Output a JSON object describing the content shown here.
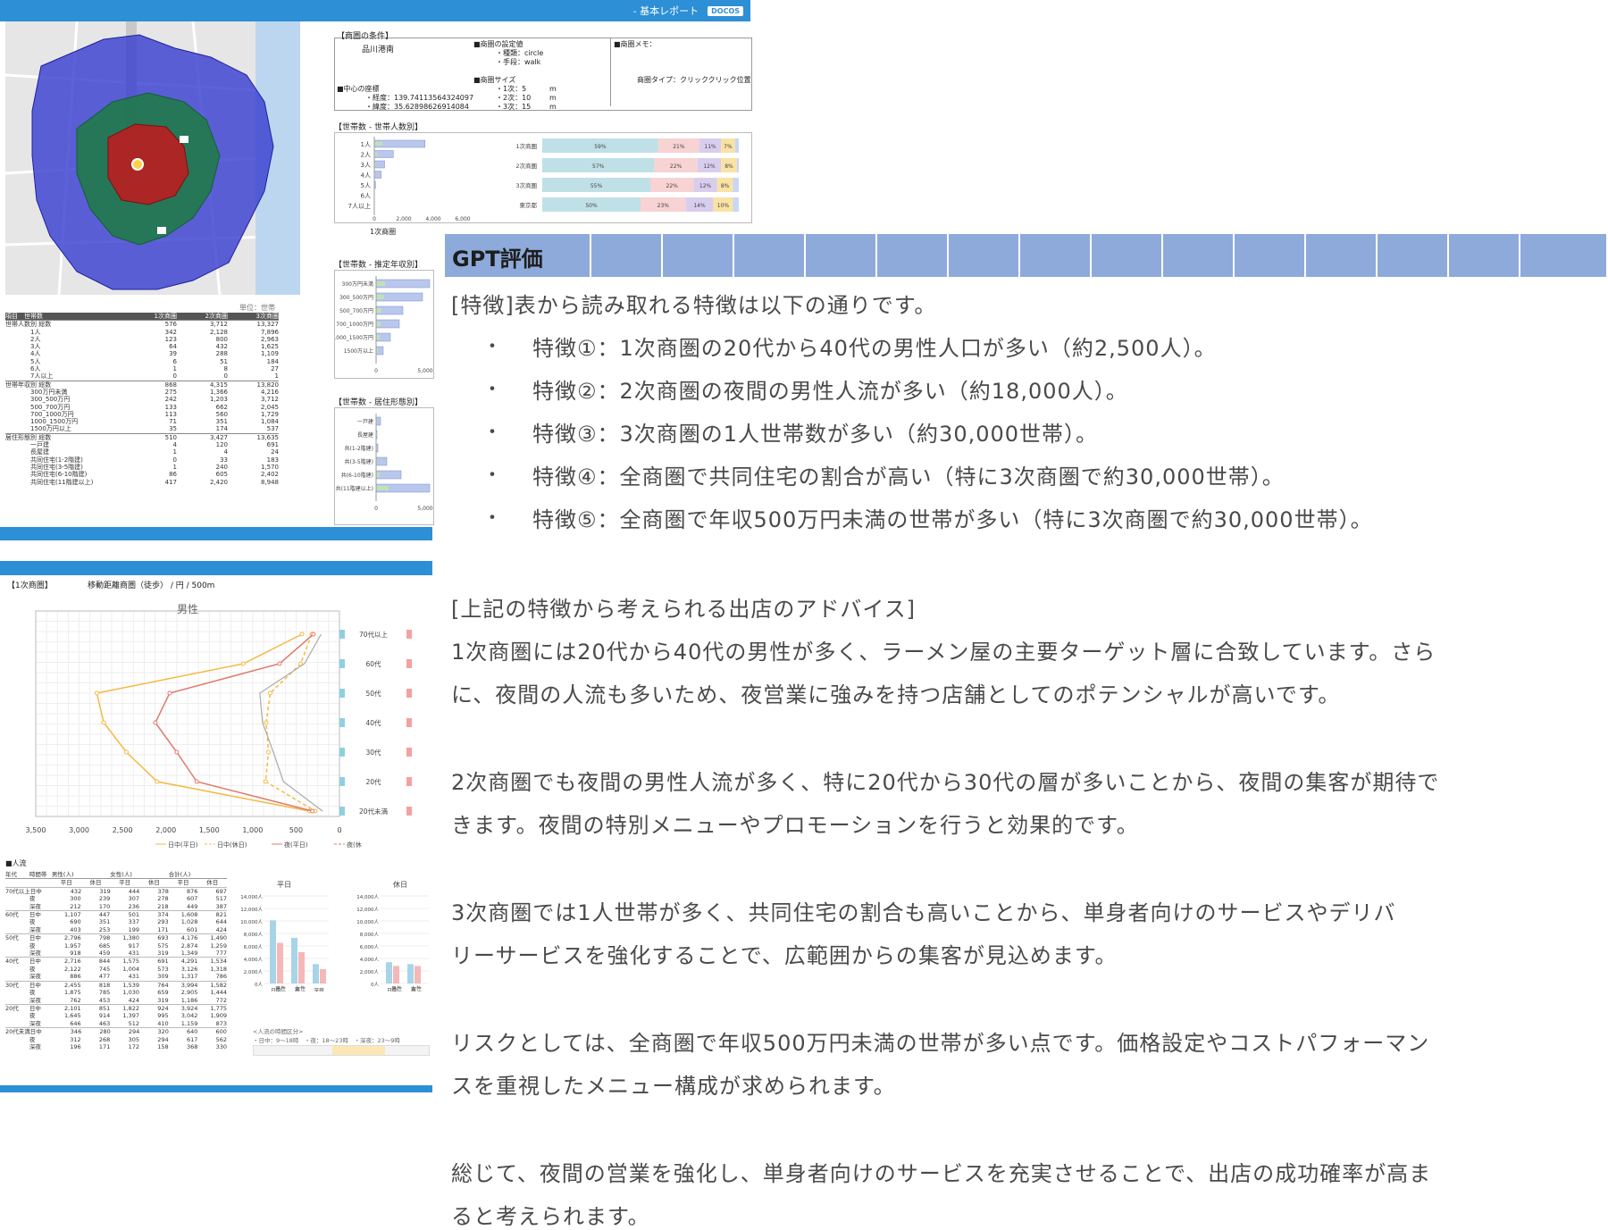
{
  "report": {
    "title": "- 基本レポート",
    "logo_text": "DOCOS",
    "conditions_header": "【商圏の条件】",
    "area_name": "品川港南",
    "center_label": "■中心の座標",
    "longitude": "・経度：139.74113564324097",
    "latitude": "・緯度：35.62898626914084",
    "settings_label": "■商圏の設定値",
    "settings_kind": "・種類：circle",
    "settings_method": "・手段：walk",
    "size_label": "■商圏サイズ",
    "size_1": "・1次：5",
    "size_2": "・2次：10",
    "size_3": "・3次：15",
    "unit_m": "m",
    "memo_label": "■商圏メモ：",
    "type_label": "商圏タイプ：クリッククリック位置",
    "hh_section": "【世帯数 - 世帯人数別】",
    "income_section": "【世帯数 - 推定年収別】",
    "housing_section": "【世帯数 - 居住形態別】",
    "unit_note": "単位：世帯",
    "hh_labels": [
      "1人",
      "2人",
      "3人",
      "4人",
      "5人",
      "6人",
      "7人以上"
    ],
    "pct_rows": [
      {
        "label": "1次商圏",
        "vals": [
          "59%",
          "21%",
          "11%",
          "7%"
        ]
      },
      {
        "label": "2次商圏",
        "vals": [
          "57%",
          "22%",
          "12%",
          "8%"
        ]
      },
      {
        "label": "3次商圏",
        "vals": [
          "55%",
          "22%",
          "12%",
          "8%"
        ]
      },
      {
        "label": "東京都",
        "vals": [
          "50%",
          "23%",
          "14%",
          "10%"
        ]
      }
    ],
    "income_labels": [
      "300万円未満",
      "300_500万円",
      "500_700万円",
      "700_1000万円",
      "1000_1500万円",
      "1500万以上"
    ],
    "housing_labels": [
      "一戸建",
      "長屋建",
      "共(1-2階建)",
      "共(3-5階建)",
      "共(6-10階建)",
      "共(11階建以上)"
    ],
    "axis_hh": [
      "0",
      "2,000",
      "4,000",
      "6,000"
    ],
    "axis_5000": [
      "0",
      "5,000"
    ],
    "legend_1": "1次商圏",
    "legend_2": "2次商圏",
    "table_head": [
      "項目",
      "世帯数",
      "1次商圏",
      "2次商圏",
      "3次商圏"
    ],
    "table_rows": [
      [
        "世帯人数別 総数",
        "",
        "576",
        "3,712",
        "13,327"
      ],
      [
        "1人",
        "",
        "342",
        "2,128",
        "7,896"
      ],
      [
        "2人",
        "",
        "123",
        "800",
        "2,963"
      ],
      [
        "3人",
        "",
        "64",
        "432",
        "1,625"
      ],
      [
        "4人",
        "",
        "39",
        "288",
        "1,109"
      ],
      [
        "5人",
        "",
        "6",
        "51",
        "184"
      ],
      [
        "6人",
        "",
        "1",
        "8",
        "27"
      ],
      [
        "7人以上",
        "",
        "0",
        "0",
        "1"
      ],
      [
        "世帯年収別 総数",
        "",
        "868",
        "4,315",
        "13,820"
      ],
      [
        "300万円未満",
        "",
        "275",
        "1,366",
        "4,216"
      ],
      [
        "300_500万円",
        "",
        "242",
        "1,203",
        "3,712"
      ],
      [
        "500_700万円",
        "",
        "133",
        "662",
        "2,045"
      ],
      [
        "700_1000万円",
        "",
        "113",
        "560",
        "1,729"
      ],
      [
        "1000_1500万円",
        "",
        "71",
        "351",
        "1,084"
      ],
      [
        "1500万円以上",
        "",
        "35",
        "174",
        "537"
      ],
      [
        "居住形態別 総数",
        "",
        "510",
        "3,427",
        "13,635"
      ],
      [
        "一戸建",
        "",
        "4",
        "120",
        "691"
      ],
      [
        "長屋建",
        "",
        "1",
        "4",
        "24"
      ],
      [
        "共同住宅(1-2階建)",
        "",
        "0",
        "33",
        "183"
      ],
      [
        "共同住宅(3-5階建)",
        "",
        "1",
        "240",
        "1,570"
      ],
      [
        "共同住宅(6-10階建)",
        "",
        "86",
        "605",
        "2,402"
      ],
      [
        "共同住宅(11階建以上)",
        "",
        "417",
        "2,420",
        "8,948"
      ]
    ]
  },
  "panel2": {
    "section": "【1次商圏】",
    "subtitle": "移動距離商圏（徒歩） / 円 / 500m",
    "chart_title": "男性",
    "age_labels": [
      "70代以上",
      "60代",
      "50代",
      "40代",
      "30代",
      "20代",
      "20代未満"
    ],
    "x_ticks": [
      "3,500",
      "3,000",
      "2,500",
      "2,000",
      "1,500",
      "1,000",
      "500",
      "0"
    ],
    "legend": [
      "日中(平日)",
      "日中(休日)",
      "夜(平日)",
      "夜(休"
    ],
    "flow_label": "■人流",
    "flow_head": [
      "年代",
      "時間帯",
      "男性(人)",
      "女性(人)",
      "合計(人)"
    ],
    "flow_sub": [
      "平日",
      "休日",
      "平日",
      "休日",
      "平日",
      "休日"
    ],
    "flow_rows": [
      [
        "70代以上",
        "日中",
        "432",
        "319",
        "444",
        "378",
        "876",
        "697"
      ],
      [
        "",
        "夜",
        "300",
        "239",
        "307",
        "278",
        "607",
        "517"
      ],
      [
        "",
        "深夜",
        "212",
        "170",
        "236",
        "218",
        "449",
        "387"
      ],
      [
        "60代",
        "日中",
        "1,107",
        "447",
        "501",
        "374",
        "1,608",
        "821"
      ],
      [
        "",
        "夜",
        "690",
        "351",
        "337",
        "293",
        "1,028",
        "644"
      ],
      [
        "",
        "深夜",
        "403",
        "253",
        "199",
        "171",
        "601",
        "424"
      ],
      [
        "50代",
        "日中",
        "2,796",
        "798",
        "1,380",
        "693",
        "4,176",
        "1,490"
      ],
      [
        "",
        "夜",
        "1,957",
        "685",
        "917",
        "575",
        "2,874",
        "1,259"
      ],
      [
        "",
        "深夜",
        "918",
        "459",
        "431",
        "319",
        "1,349",
        "777"
      ],
      [
        "40代",
        "日中",
        "2,716",
        "844",
        "1,575",
        "691",
        "4,291",
        "1,534"
      ],
      [
        "",
        "夜",
        "2,122",
        "745",
        "1,004",
        "573",
        "3,126",
        "1,318"
      ],
      [
        "",
        "深夜",
        "886",
        "477",
        "431",
        "309",
        "1,317",
        "786"
      ],
      [
        "30代",
        "日中",
        "2,455",
        "818",
        "1,539",
        "764",
        "3,994",
        "1,582"
      ],
      [
        "",
        "夜",
        "1,875",
        "785",
        "1,030",
        "659",
        "2,905",
        "1,444"
      ],
      [
        "",
        "深夜",
        "762",
        "453",
        "424",
        "319",
        "1,186",
        "772"
      ],
      [
        "20代",
        "日中",
        "2,101",
        "851",
        "1,822",
        "924",
        "3,924",
        "1,775"
      ],
      [
        "",
        "夜",
        "1,645",
        "914",
        "1,397",
        "995",
        "3,042",
        "1,909"
      ],
      [
        "",
        "深夜",
        "646",
        "463",
        "512",
        "410",
        "1,159",
        "873"
      ],
      [
        "20代未満",
        "日中",
        "346",
        "280",
        "294",
        "320",
        "640",
        "600"
      ],
      [
        "",
        "夜",
        "312",
        "268",
        "305",
        "294",
        "617",
        "562"
      ],
      [
        "",
        "深夜",
        "196",
        "171",
        "172",
        "158",
        "368",
        "330"
      ]
    ],
    "mini_titles": [
      "平日",
      "休日"
    ],
    "mini_y": [
      "14,000人",
      "12,000人",
      "10,000人",
      "8,000人",
      "6,000人",
      "4,000人",
      "2,000人",
      "0人"
    ],
    "mini_x": [
      "日中",
      "夜",
      "深夜"
    ],
    "mini_legend": [
      "男性",
      "女性"
    ],
    "time_note": "<人流の時間区分>",
    "time_segments": "・日中：9～18時　・夜：18～23時　・深夜：23～9時"
  },
  "gpt": {
    "title": "GPT評価",
    "intro": "[特徴]表から読み取れる特徴は以下の通りです。",
    "features": [
      "特徴①：1次商圏の20代から40代の男性人口が多い（約2,500人）。",
      "特徴②：2次商圏の夜間の男性人流が多い（約18,000人）。",
      "特徴③：3次商圏の1人世帯数が多い（約30,000世帯）。",
      "特徴④：全商圏で共同住宅の割合が高い（特に3次商圏で約30,000世帯）。",
      "特徴⑤：全商圏で年収500万円未満の世帯が多い（特に3次商圏で約30,000世帯）。"
    ],
    "bullet": "・",
    "advice_header": "[上記の特徴から考えられる出店のアドバイス]",
    "para1": [
      "1次商圏には20代から40代の男性が多く、ラーメン屋の主要ターゲット層に合致しています。さら",
      "に、夜間の人流も多いため、夜営業に強みを持つ店舗としてのポテンシャルが高いです。"
    ],
    "para2": [
      "2次商圏でも夜間の男性人流が多く、特に20代から30代の層が多いことから、夜間の集客が期待で",
      "きます。夜間の特別メニューやプロモーションを行うと効果的です。"
    ],
    "para3": [
      "3次商圏では1人世帯が多く、共同住宅の割合も高いことから、単身者向けのサービスやデリバ",
      "リーサービスを強化することで、広範囲からの集客が見込めます。"
    ],
    "para4": [
      "リスクとしては、全商圏で年収500万円未満の世帯が多い点です。価格設定やコストパフォーマン",
      "スを重視したメニュー構成が求められます。"
    ],
    "para5": [
      "総じて、夜間の営業を強化し、単身者向けのサービスを充実させることで、出店の成功確率が高ま",
      "ると考えられます。"
    ]
  },
  "chart_data": [
    {
      "type": "bar",
      "title": "世帯数 - 世帯人数別",
      "categories": [
        "1人",
        "2人",
        "3人",
        "4人",
        "5人",
        "6人",
        "7人以上"
      ],
      "series": [
        {
          "name": "1次商圏",
          "values": [
            342,
            123,
            64,
            39,
            6,
            1,
            0
          ]
        },
        {
          "name": "2次商圏",
          "values": [
            2128,
            800,
            432,
            288,
            51,
            8,
            0
          ]
        }
      ],
      "xlim": [
        0,
        6000
      ]
    },
    {
      "type": "line",
      "title": "男性",
      "categories": [
        "70代以上",
        "60代",
        "50代",
        "40代",
        "30代",
        "20代",
        "20代未満"
      ],
      "series": [
        {
          "name": "日中(平日)",
          "values": [
            432,
            1107,
            2796,
            2716,
            2455,
            2101,
            346
          ]
        },
        {
          "name": "日中(休日)",
          "values": [
            319,
            447,
            798,
            844,
            818,
            851,
            280
          ]
        },
        {
          "name": "夜(平日)",
          "values": [
            300,
            690,
            1957,
            2122,
            1875,
            1645,
            312
          ]
        }
      ],
      "xlim": [
        3500,
        0
      ]
    }
  ]
}
